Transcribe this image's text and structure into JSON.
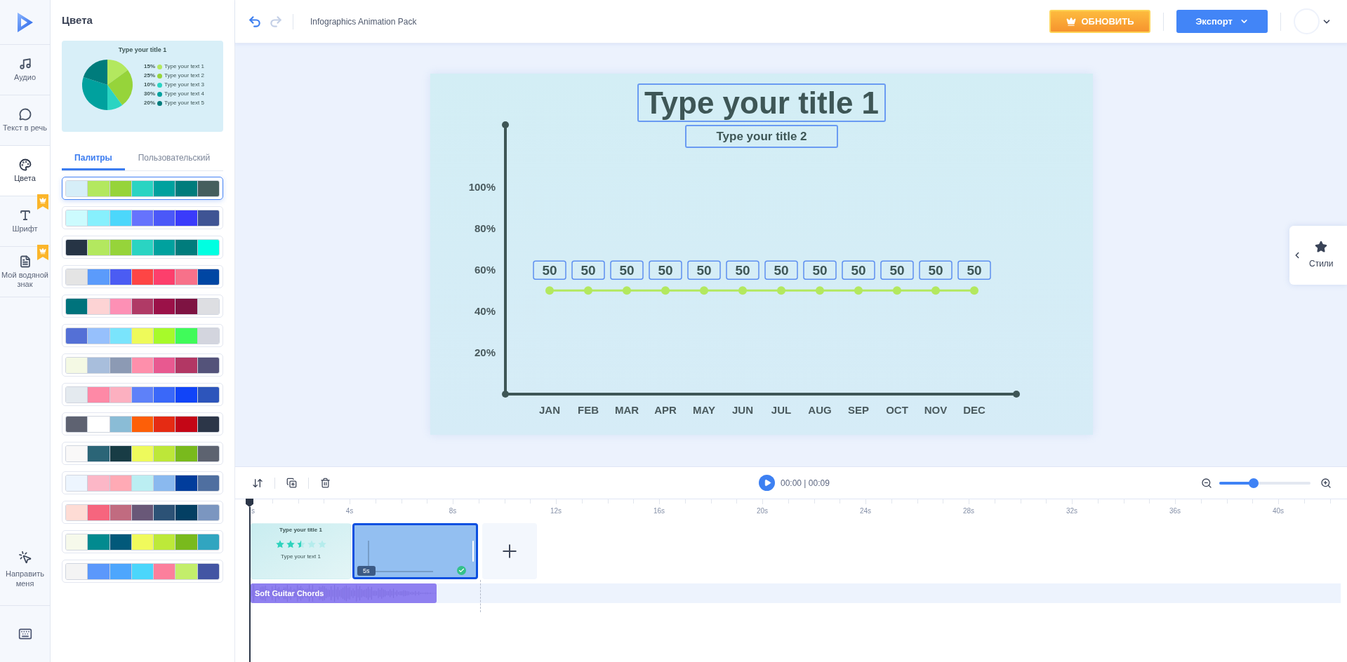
{
  "rail": [
    {
      "label": "Аудио",
      "selected": false,
      "premium": false
    },
    {
      "label": "Текст в речь",
      "selected": false,
      "premium": false
    },
    {
      "label": "Цвета",
      "selected": true,
      "premium": false
    },
    {
      "label": "Шрифт",
      "selected": false,
      "premium": true
    },
    {
      "label": "Мой водяной знак",
      "selected": false,
      "premium": true
    }
  ],
  "rail_bottom": {
    "guide": "Направить меня"
  },
  "panel": {
    "title": "Цвета",
    "preview": {
      "title": "Type your title 1",
      "legend": [
        {
          "pct": "15%",
          "label": "Type your text 1",
          "color": "#b3e85f"
        },
        {
          "pct": "25%",
          "label": "Type your text 2",
          "color": "#96d43a"
        },
        {
          "pct": "10%",
          "label": "Type your text 3",
          "color": "#2ad4c2"
        },
        {
          "pct": "30%",
          "label": "Type your text 4",
          "color": "#00a19e"
        },
        {
          "pct": "20%",
          "label": "Type your text 5",
          "color": "#007c7c"
        }
      ],
      "chart_data": {
        "type": "pie",
        "values": [
          15,
          25,
          10,
          30,
          20
        ]
      }
    },
    "tabs": [
      {
        "label": "Палитры",
        "selected": true
      },
      {
        "label": "Пользовательский",
        "selected": false
      }
    ],
    "palettes": [
      {
        "selected": true,
        "swatches": [
          {
            "color": "#d6eef8"
          },
          {
            "color": "#b3e85f"
          },
          {
            "color": "#96d43a"
          },
          {
            "color": "#2ad4c2"
          },
          {
            "color": "#00a19e"
          },
          {
            "color": "#007c7c"
          },
          {
            "color": "#455e5e"
          }
        ]
      },
      {
        "selected": false,
        "swatches": [
          {
            "color": "#ccfbfe"
          },
          {
            "color": "#87f0fd"
          },
          {
            "color": "#4cd7fb"
          },
          {
            "color": "#6673fd"
          },
          {
            "color": "#4b58f8"
          },
          {
            "color": "#3a3bfb"
          },
          {
            "color": "#3f5494"
          }
        ]
      },
      {
        "selected": false,
        "swatches": [
          {
            "color": "#263445"
          },
          {
            "color": "#b3e85f"
          },
          {
            "color": "#96d43a"
          },
          {
            "color": "#2ad4c2"
          },
          {
            "color": "#00a19e"
          },
          {
            "color": "#007c7c"
          },
          {
            "color": "#00ffe1"
          }
        ]
      },
      {
        "selected": false,
        "swatches": [
          {
            "color": "#e4e4e4"
          },
          {
            "color": "#5b9bfb"
          },
          {
            "color": "#4b5cf3"
          },
          {
            "color": "#fe4545"
          },
          {
            "color": "#fd3f6c"
          },
          {
            "color": "#f7718a"
          },
          {
            "color": "#0046a3"
          }
        ]
      },
      {
        "selected": false,
        "swatches": [
          {
            "color": "#00737c"
          },
          {
            "color": "#fdd3d4"
          },
          {
            "color": "#fd90b5"
          },
          {
            "color": "#b03a66"
          },
          {
            "color": "#9b1148"
          },
          {
            "color": "#7e1342"
          },
          {
            "color": "#dddee2"
          }
        ]
      },
      {
        "selected": false,
        "swatches": [
          {
            "color": "#5470d6"
          },
          {
            "color": "#96c0fc"
          },
          {
            "color": "#7ae4fc"
          },
          {
            "color": "#eefa5a"
          },
          {
            "color": "#a7fa2a"
          },
          {
            "color": "#40fb5a"
          },
          {
            "color": "#d3d5de"
          }
        ]
      },
      {
        "selected": false,
        "swatches": [
          {
            "color": "#f4f9e4"
          },
          {
            "color": "#a8bedc"
          },
          {
            "color": "#8c9ab4"
          },
          {
            "color": "#fe8fab"
          },
          {
            "color": "#e85990"
          },
          {
            "color": "#b23764"
          },
          {
            "color": "#54537a"
          }
        ]
      },
      {
        "selected": false,
        "swatches": [
          {
            "color": "#e4eaef"
          },
          {
            "color": "#fe89a6"
          },
          {
            "color": "#fcb0c0"
          },
          {
            "color": "#5e81f9"
          },
          {
            "color": "#3a68f9"
          },
          {
            "color": "#1144f8"
          },
          {
            "color": "#2d55bb"
          }
        ]
      },
      {
        "selected": false,
        "swatches": [
          {
            "color": "#5e6271"
          },
          {
            "color": "#ffffff"
          },
          {
            "color": "#8abcd6"
          },
          {
            "color": "#fd5f08"
          },
          {
            "color": "#e52b13"
          },
          {
            "color": "#c40616"
          },
          {
            "color": "#2c3648"
          }
        ]
      },
      {
        "selected": false,
        "swatches": [
          {
            "color": "#f9f8f8"
          },
          {
            "color": "#2b6577"
          },
          {
            "color": "#183c45"
          },
          {
            "color": "#eefa5c"
          },
          {
            "color": "#bde739"
          },
          {
            "color": "#79ba1d"
          },
          {
            "color": "#5d6370"
          }
        ]
      },
      {
        "selected": false,
        "swatches": [
          {
            "color": "#edf5fe"
          },
          {
            "color": "#fcb7c7"
          },
          {
            "color": "#ffaab5"
          },
          {
            "color": "#bbeef2"
          },
          {
            "color": "#8ab9ef"
          },
          {
            "color": "#013d9c"
          },
          {
            "color": "#4f6fa0"
          }
        ]
      },
      {
        "selected": false,
        "swatches": [
          {
            "color": "#fedcd5"
          },
          {
            "color": "#f6657e"
          },
          {
            "color": "#c16b80"
          },
          {
            "color": "#695878"
          },
          {
            "color": "#2c5276"
          },
          {
            "color": "#033f63"
          },
          {
            "color": "#7b96c0"
          }
        ]
      },
      {
        "selected": false,
        "swatches": [
          {
            "color": "#f6f9eb"
          },
          {
            "color": "#028a8f"
          },
          {
            "color": "#02597a"
          },
          {
            "color": "#f0fa5c"
          },
          {
            "color": "#bde939"
          },
          {
            "color": "#79ba1d"
          },
          {
            "color": "#31a5c0"
          }
        ]
      },
      {
        "selected": false,
        "swatches": [
          {
            "color": "#f4f4f4"
          },
          {
            "color": "#5b98fb"
          },
          {
            "color": "#4da6fd"
          },
          {
            "color": "#4bd6fb"
          },
          {
            "color": "#fc7f9c"
          },
          {
            "color": "#c3ee6b"
          },
          {
            "color": "#4355a3"
          }
        ]
      }
    ]
  },
  "topbar": {
    "project_title": "Infographics Animation Pack",
    "upgrade": "ОБНОВИТЬ",
    "export": "Экспорт"
  },
  "slide": {
    "title": "Type your title 1",
    "subtitle": "Type your title 2",
    "chart_data": {
      "type": "line",
      "categories": [
        "JAN",
        "FEB",
        "MAR",
        "APR",
        "MAY",
        "JUN",
        "JUL",
        "AUG",
        "SEP",
        "OCT",
        "NOV",
        "DEC"
      ],
      "series": [
        {
          "color": "#b3e85f",
          "marker": true,
          "values": [
            50,
            50,
            50,
            50,
            50,
            50,
            50,
            50,
            50,
            50,
            50,
            50
          ]
        }
      ],
      "ylim": [
        0,
        130
      ],
      "yticks": [
        {
          "value": 20,
          "label": "20%"
        },
        {
          "value": 40,
          "label": "40%"
        },
        {
          "value": 60,
          "label": "60%"
        },
        {
          "value": 80,
          "label": "80%"
        },
        {
          "value": 100,
          "label": "100%"
        }
      ],
      "data_labels": true
    }
  },
  "styles_tab": {
    "label": "Стили"
  },
  "timeline": {
    "time": "00:00 | 00:09",
    "zoom": {
      "level": 0.36
    },
    "ruler": [
      "s",
      "4s",
      "8s",
      "12s",
      "16s",
      "20s",
      "24s",
      "28s",
      "32s",
      "36s",
      "40s"
    ],
    "clips": [
      {
        "kind": "rating",
        "title": "Type your title 1",
        "caption": "Type your text 1",
        "stars": 2.5,
        "selected": false
      },
      {
        "kind": "chart",
        "duration": "5s",
        "selected": true
      }
    ],
    "audio": {
      "title": "Soft Guitar Chords"
    }
  }
}
